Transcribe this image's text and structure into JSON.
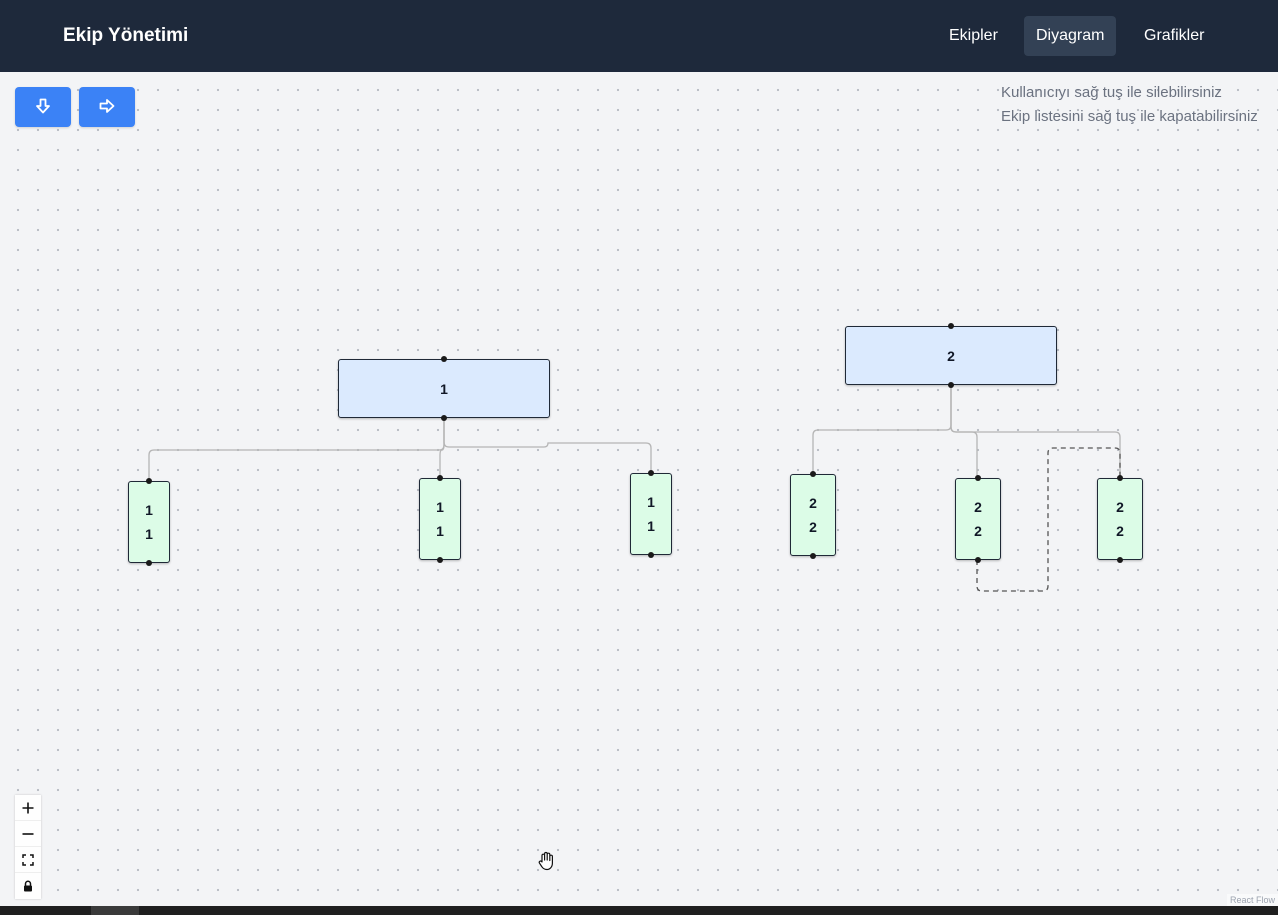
{
  "navbar": {
    "brand": "Ekip Yönetimi",
    "items": [
      {
        "label": "Ekipler",
        "active": false
      },
      {
        "label": "Diyagram",
        "active": true
      },
      {
        "label": "Grafikler",
        "active": false
      }
    ]
  },
  "toolbar": {
    "vertical_layout_icon": "arrow-down-icon",
    "horizontal_layout_icon": "arrow-right-icon"
  },
  "hints": [
    "Kullanıcıyı sağ tuş ile silebilirsiniz",
    "Ekip listesini sağ tuş ile kapatabilirsiniz"
  ],
  "diagram": {
    "teams": [
      {
        "label": "1",
        "members": [
          [
            "1",
            "1"
          ],
          [
            "1",
            "1"
          ],
          [
            "1",
            "1"
          ]
        ]
      },
      {
        "label": "2",
        "members": [
          [
            "2",
            "2"
          ],
          [
            "2",
            "2"
          ],
          [
            "2",
            "2"
          ]
        ]
      }
    ]
  },
  "controls": [
    "zoom-in-icon",
    "zoom-out-icon",
    "fit-view-icon",
    "lock-icon"
  ],
  "attribution": "React Flow",
  "colors": {
    "navbar_bg": "#1e293b",
    "nav_active_bg": "#334155",
    "button_blue": "#3b82f6",
    "team_node_bg": "#dbeafe",
    "member_node_bg": "#dcfce7",
    "edge": "#b5b5b5",
    "dashed_edge": "#555555"
  }
}
